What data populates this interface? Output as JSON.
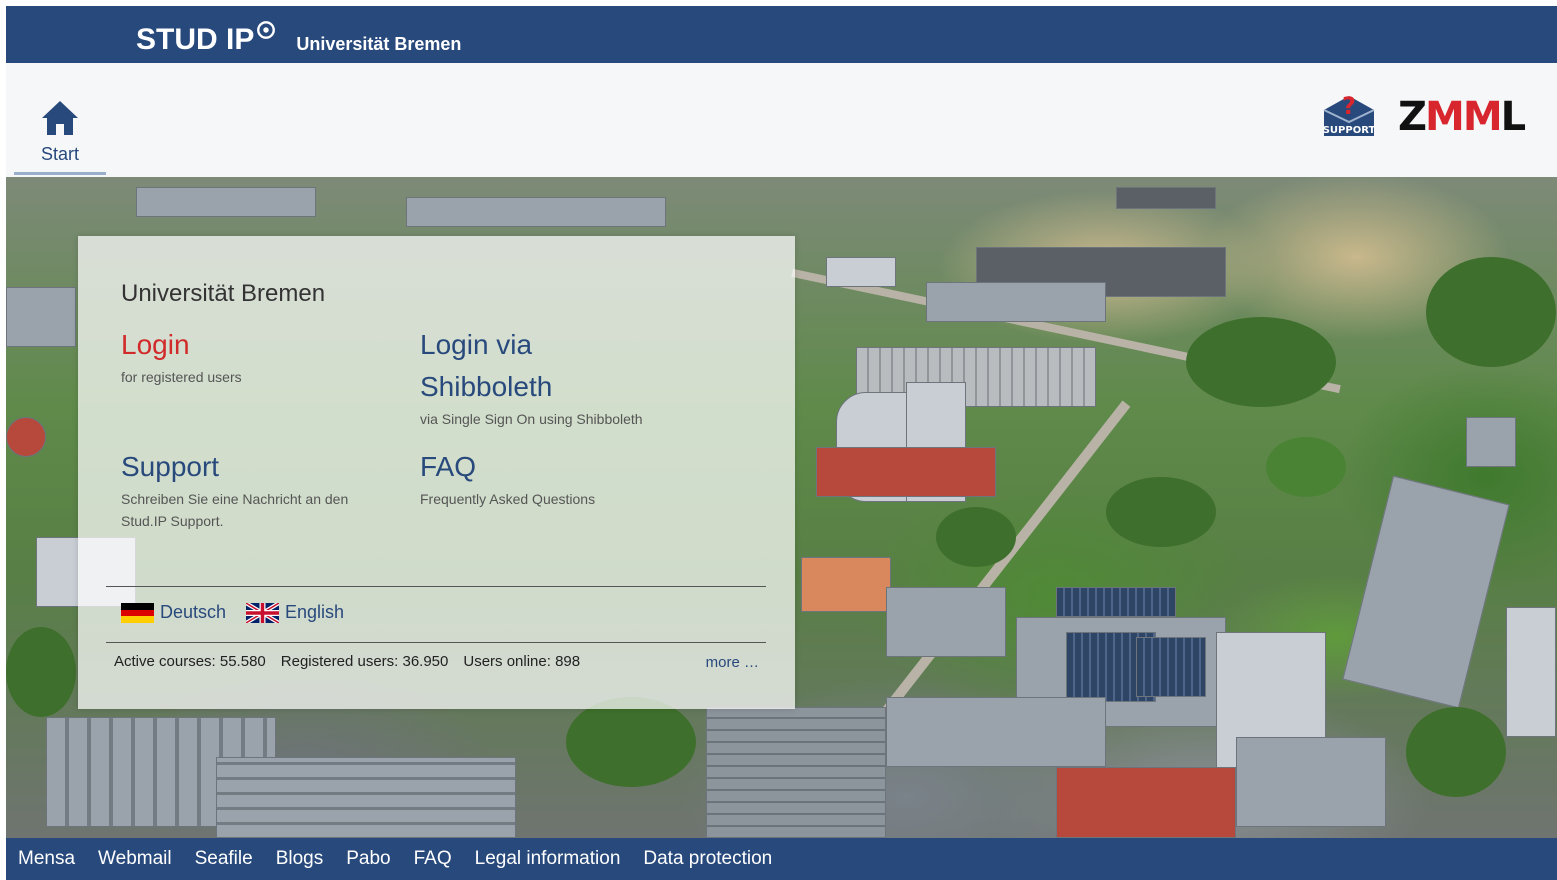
{
  "header": {
    "brand": "STUD IP",
    "university": "Universität Bremen"
  },
  "nav": {
    "start_label": "Start",
    "support_logo_text": "SUPPORT",
    "zmml_logo": "ZMML"
  },
  "login_panel": {
    "title": "Universität Bremen",
    "tiles": [
      {
        "title": "Login",
        "description": "for registered users"
      },
      {
        "title_line1": "Login via",
        "title_line2": "Shibboleth",
        "description": "via Single Sign On using Shibboleth"
      },
      {
        "title": "Support",
        "description_line1": "Schreiben Sie eine Nachricht an den",
        "description_line2": "Stud.IP Support."
      },
      {
        "title": "FAQ",
        "description": "Frequently Asked Questions"
      }
    ],
    "languages": [
      {
        "label": "Deutsch",
        "flag": "german-flag-icon"
      },
      {
        "label": "English",
        "flag": "uk-flag-icon"
      }
    ],
    "stats": {
      "active_courses": "Active courses: 55.580",
      "registered_users": "Registered users: 36.950",
      "users_online": "Users online: 898",
      "more": "more …"
    }
  },
  "footer": {
    "links": [
      "Mensa",
      "Webmail",
      "Seafile",
      "Blogs",
      "Pabo",
      "FAQ",
      "Legal information",
      "Data protection"
    ]
  },
  "colors": {
    "brand_blue": "#28497c",
    "login_red": "#d12a2a",
    "zmml_red": "#d8262f"
  }
}
